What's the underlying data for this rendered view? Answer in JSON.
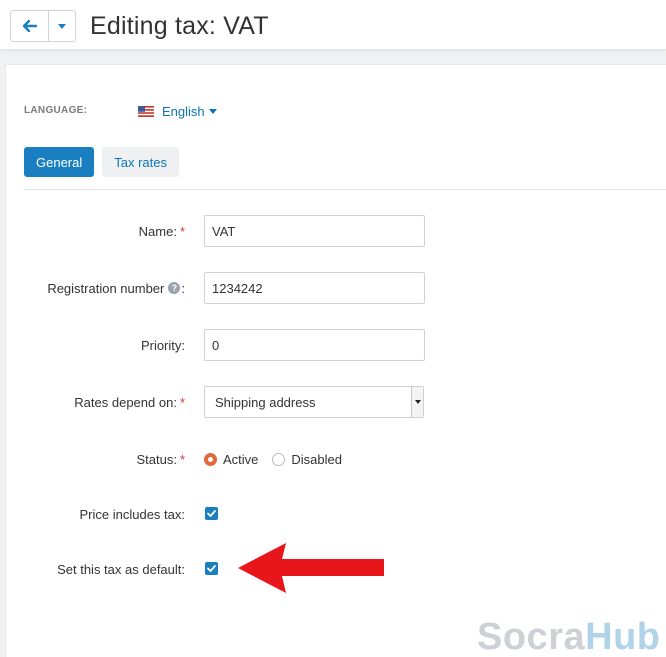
{
  "header": {
    "title": "Editing tax: VAT",
    "back_icon": "arrow-left-icon",
    "menu_icon": "caret-down-icon"
  },
  "language": {
    "label": "LANGUAGE:",
    "value": "English",
    "flag_icon": "us-flag-icon"
  },
  "tabs": [
    {
      "label": "General",
      "active": true
    },
    {
      "label": "Tax rates",
      "active": false
    }
  ],
  "form": {
    "name": {
      "label": "Name:",
      "value": "VAT",
      "required": true
    },
    "registration_number": {
      "label": "Registration number",
      "value": "1234242",
      "help_icon": "question-circle-icon"
    },
    "priority": {
      "label": "Priority:",
      "value": "0"
    },
    "rates_depend_on": {
      "label": "Rates depend on:",
      "value": "Shipping address",
      "required": true
    },
    "status": {
      "label": "Status:",
      "required": true,
      "options": [
        {
          "label": "Active",
          "selected": true
        },
        {
          "label": "Disabled",
          "selected": false
        }
      ]
    },
    "price_includes_tax": {
      "label": "Price includes tax:",
      "checked": true
    },
    "set_default": {
      "label": "Set this tax as default:",
      "checked": true
    }
  },
  "colors": {
    "accent": "#1a7fc1",
    "link": "#0b74b4",
    "required": "#d9352b",
    "radio_selected": "#e06a3a",
    "annotation_arrow": "#e8151b"
  },
  "watermark": {
    "part1": "Socra",
    "part2": "Hub"
  }
}
